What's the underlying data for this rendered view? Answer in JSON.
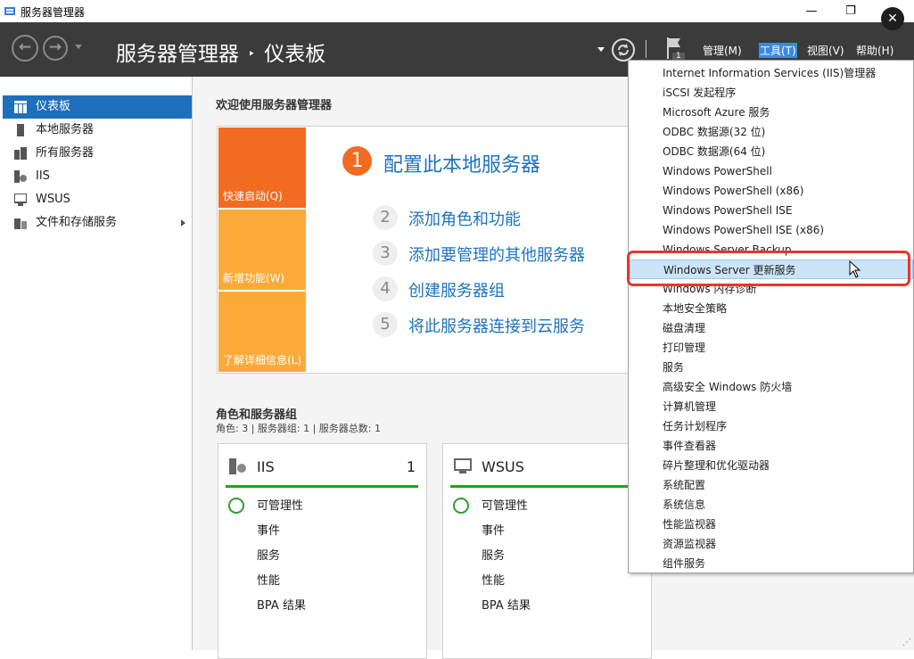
{
  "window": {
    "title": "服务器管理器",
    "minimize": "—",
    "maximize": "❐"
  },
  "header": {
    "breadcrumb_app": "服务器管理器",
    "breadcrumb_sep": "‣",
    "breadcrumb_page": "仪表板",
    "notification_count": "1"
  },
  "menubar": [
    {
      "label": "管理(M)"
    },
    {
      "label": "工具(T)",
      "active": true
    },
    {
      "label": "视图(V)"
    },
    {
      "label": "帮助(H)"
    }
  ],
  "sidebar": {
    "items": [
      {
        "label": "仪表板",
        "icon": "dashboard-icon",
        "selected": true
      },
      {
        "label": "本地服务器",
        "icon": "server-icon"
      },
      {
        "label": "所有服务器",
        "icon": "servers-icon"
      },
      {
        "label": "IIS",
        "icon": "iis-icon"
      },
      {
        "label": "WSUS",
        "icon": "wsus-icon"
      },
      {
        "label": "文件和存储服务",
        "icon": "storage-icon",
        "has_arrow": true
      }
    ]
  },
  "main": {
    "welcome_title": "欢迎使用服务器管理器",
    "tiles": [
      {
        "label": "快速启动(Q)",
        "color": "#f26b22"
      },
      {
        "label": "新增功能(W)",
        "color": "#fbaa3a"
      },
      {
        "label": "了解详细信息(L)",
        "color": "#fbaa3a"
      }
    ],
    "steps": [
      {
        "num": "1",
        "text": "配置此本地服务器"
      },
      {
        "num": "2",
        "text": "添加角色和功能"
      },
      {
        "num": "3",
        "text": "添加要管理的其他服务器"
      },
      {
        "num": "4",
        "text": "创建服务器组"
      },
      {
        "num": "5",
        "text": "将此服务器连接到云服务"
      }
    ],
    "roles_title": "角色和服务器组",
    "roles_summary": "角色: 3 | 服务器组: 1 | 服务器总数: 1",
    "cards": [
      {
        "name": "IIS",
        "count": "1",
        "rows": [
          "可管理性",
          "事件",
          "服务",
          "性能",
          "BPA 结果"
        ]
      },
      {
        "name": "WSUS",
        "count": "",
        "rows": [
          "可管理性",
          "事件",
          "服务",
          "性能",
          "BPA 结果"
        ]
      }
    ]
  },
  "tools_menu": {
    "items": [
      "Internet Information Services (IIS)管理器",
      "iSCSI 发起程序",
      "Microsoft Azure 服务",
      "ODBC 数据源(32 位)",
      "ODBC 数据源(64 位)",
      "Windows PowerShell",
      "Windows PowerShell (x86)",
      "Windows PowerShell ISE",
      "Windows PowerShell ISE (x86)",
      "Windows Server Backup",
      "Windows Server 更新服务",
      "Windows 内存诊断",
      "本地安全策略",
      "磁盘清理",
      "打印管理",
      "服务",
      "高级安全 Windows 防火墙",
      "计算机管理",
      "任务计划程序",
      "事件查看器",
      "碎片整理和优化驱动器",
      "系统配置",
      "系统信息",
      "性能监视器",
      "资源监视器",
      "组件服务"
    ],
    "highlighted_index": 10
  },
  "colors": {
    "accent": "#1e6fbb",
    "link": "#1e73be",
    "highlight_box": "#e8362b",
    "toolbar": "#3b3b3b"
  }
}
